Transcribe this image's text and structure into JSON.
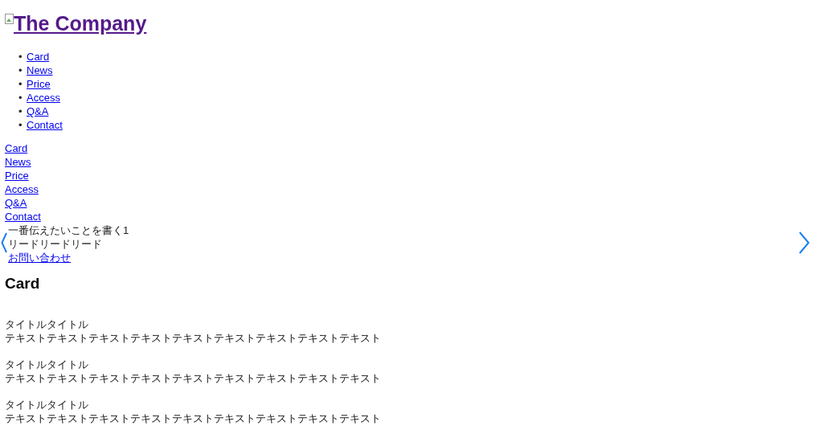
{
  "logo": {
    "text": "The Company"
  },
  "nav": [
    {
      "bullet": "•",
      "label": "Card"
    },
    {
      "bullet": "•",
      "label": "News"
    },
    {
      "bullet": "•",
      "label": "Price"
    },
    {
      "bullet": "•",
      "label": "Access"
    },
    {
      "bullet": "•",
      "label": "Q&A"
    },
    {
      "bullet": "•",
      "label": "Contact"
    }
  ],
  "menu": [
    "Card",
    "News",
    "Price",
    "Access",
    "Q&A",
    "Contact"
  ],
  "hero": {
    "heading": "一番伝えたいことを書く1",
    "lead": "リードリードリード",
    "link": "お問い合わせ"
  },
  "section": {
    "title": "Card",
    "cards": [
      {
        "title": "タイトルタイトル",
        "text": "テキストテキストテキストテキストテキストテキストテキストテキストテキスト"
      },
      {
        "title": "タイトルタイトル",
        "text": "テキストテキストテキストテキストテキストテキストテキストテキストテキスト"
      },
      {
        "title": "タイトルタイトル",
        "text": "テキストテキストテキストテキストテキストテキストテキストテキストテキスト"
      }
    ]
  }
}
